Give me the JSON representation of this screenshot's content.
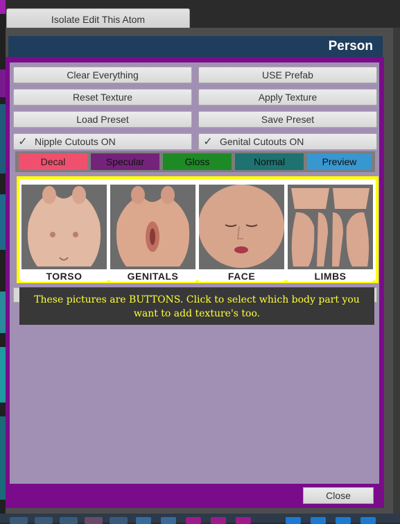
{
  "isolate_button_label": "Isolate Edit This Atom",
  "panel": {
    "title": "Person"
  },
  "actions": {
    "clear_everything": "Clear Everything",
    "use_prefab": "USE Prefab",
    "reset_texture": "Reset Texture",
    "apply_texture": "Apply Texture",
    "load_preset": "Load Preset",
    "save_preset": "Save Preset"
  },
  "toggles": {
    "nipple_cutouts": {
      "label": "Nipple Cutouts ON",
      "checked": true
    },
    "genital_cutouts": {
      "label": "Genital Cutouts ON",
      "checked": true
    }
  },
  "tabs": [
    {
      "label": "Decal",
      "color": "#f0506e"
    },
    {
      "label": "Specular",
      "color": "#74237a"
    },
    {
      "label": "Gloss",
      "color": "#1e8a26"
    },
    {
      "label": "Normal",
      "color": "#1e7272"
    },
    {
      "label": "Preview",
      "color": "#3897d0"
    }
  ],
  "body_parts": [
    {
      "label": "TORSO"
    },
    {
      "label": "GENITALS"
    },
    {
      "label": "FACE"
    },
    {
      "label": "LIMBS"
    }
  ],
  "tooltip": "These pictures are BUTTONS. Click to select which body part you want to add texture's too.",
  "close_label": "Close",
  "colors": {
    "title_bar": "#1f3d5c",
    "panel": "#7a0c8c",
    "inner": "#a290b4",
    "highlight_border": "#ffff00",
    "tooltip_text": "#ffff3a"
  }
}
